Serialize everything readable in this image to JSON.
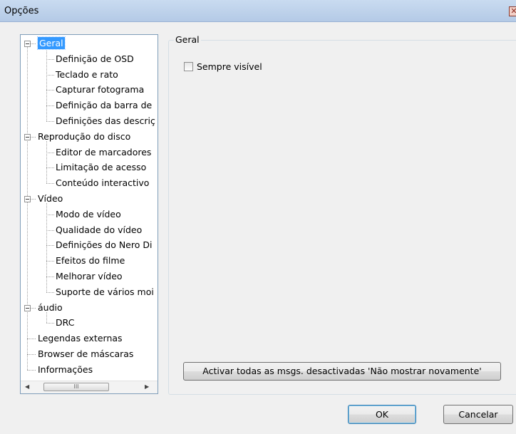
{
  "window": {
    "title": "Opções",
    "close_glyph": "✕"
  },
  "tree": {
    "nodes": [
      {
        "label": "Geral",
        "level": 0,
        "expander": true,
        "selected": true
      },
      {
        "label": "Definição de OSD",
        "level": 1
      },
      {
        "label": "Teclado e rato",
        "level": 1
      },
      {
        "label": "Capturar fotograma",
        "level": 1
      },
      {
        "label": "Definição da barra de",
        "level": 1
      },
      {
        "label": "Definições das descriç",
        "level": 1
      },
      {
        "label": "Reprodução do disco",
        "level": 0,
        "expander": true
      },
      {
        "label": "Editor de marcadores",
        "level": 1
      },
      {
        "label": "Limitação de acesso",
        "level": 1
      },
      {
        "label": "Conteúdo interactivo",
        "level": 1
      },
      {
        "label": "Vídeo",
        "level": 0,
        "expander": true
      },
      {
        "label": "Modo de vídeo",
        "level": 1
      },
      {
        "label": "Qualidade do vídeo",
        "level": 1
      },
      {
        "label": "Definições do Nero Di",
        "level": 1
      },
      {
        "label": "Efeitos do filme",
        "level": 1
      },
      {
        "label": "Melhorar vídeo",
        "level": 1
      },
      {
        "label": "Suporte de vários moi",
        "level": 1
      },
      {
        "label": "áudio",
        "level": 0,
        "expander": true
      },
      {
        "label": "DRC",
        "level": 1
      },
      {
        "label": "Legendas externas",
        "level": 0
      },
      {
        "label": "Browser de máscaras",
        "level": 0
      },
      {
        "label": "Informações",
        "level": 0
      }
    ],
    "scroll_left_glyph": "◀",
    "scroll_right_glyph": "▶",
    "scroll_thumb_grip": "III"
  },
  "group": {
    "title": "Geral",
    "checkbox_label": "Sempre visível",
    "checkbox_checked": false,
    "activate_button": "Activar todas as msgs. desactivadas 'Não mostrar novamente'"
  },
  "buttons": {
    "ok": "OK",
    "cancel": "Cancelar"
  }
}
